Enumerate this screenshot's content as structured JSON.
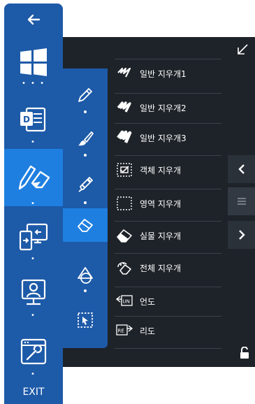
{
  "left_bar": {
    "back_icon": "arrow-left-icon",
    "items": [
      {
        "name": "windows-start",
        "icon": "windows-logo-icon"
      },
      {
        "name": "document",
        "icon": "document-d-icon"
      },
      {
        "name": "pen-eraser",
        "icon": "pen-eraser-icon",
        "active": true
      },
      {
        "name": "screen-share",
        "icon": "screen-share-icon"
      },
      {
        "name": "presenter",
        "icon": "presenter-icon"
      },
      {
        "name": "settings-tool",
        "icon": "settings-wrench-icon"
      }
    ],
    "exit_label": "EXIT"
  },
  "tool_column": {
    "items": [
      {
        "name": "pen",
        "icon": "pen-icon"
      },
      {
        "name": "brush",
        "icon": "brush-icon"
      },
      {
        "name": "highlighter",
        "icon": "highlighter-icon"
      },
      {
        "name": "eraser",
        "icon": "eraser-icon",
        "active": true
      },
      {
        "name": "shapes",
        "icon": "shapes-icon"
      },
      {
        "name": "select",
        "icon": "select-icon"
      }
    ]
  },
  "eraser_menu": {
    "items": [
      {
        "label": "일반 지우개1",
        "icon": "eraser-stroke-1-icon"
      },
      {
        "label": "일반 지우개2",
        "icon": "eraser-stroke-2-icon"
      },
      {
        "label": "일반 지우개3",
        "icon": "eraser-stroke-3-icon"
      },
      {
        "label": "객체 지우개",
        "icon": "object-eraser-icon"
      },
      {
        "label": "영역 지우개",
        "icon": "area-eraser-icon"
      },
      {
        "label": "실물 지우개",
        "icon": "real-eraser-icon"
      },
      {
        "label": "전체 지우개",
        "icon": "clear-all-icon"
      },
      {
        "label": "언도",
        "icon": "undo-icon",
        "badge": "UN"
      },
      {
        "label": "리도",
        "icon": "redo-icon",
        "badge": "RE"
      }
    ]
  },
  "right_nav": {
    "prev_icon": "chevron-left-icon",
    "menu_icon": "hamburger-icon",
    "next_icon": "chevron-right-icon",
    "lock_icon": "unlock-icon",
    "collapse_icon": "collapse-diagonal-icon"
  },
  "colors": {
    "panel": "#1e2329",
    "bar_blue": "#1d5aa8",
    "active_blue": "#1e7fe0",
    "text": "#ffffff"
  }
}
